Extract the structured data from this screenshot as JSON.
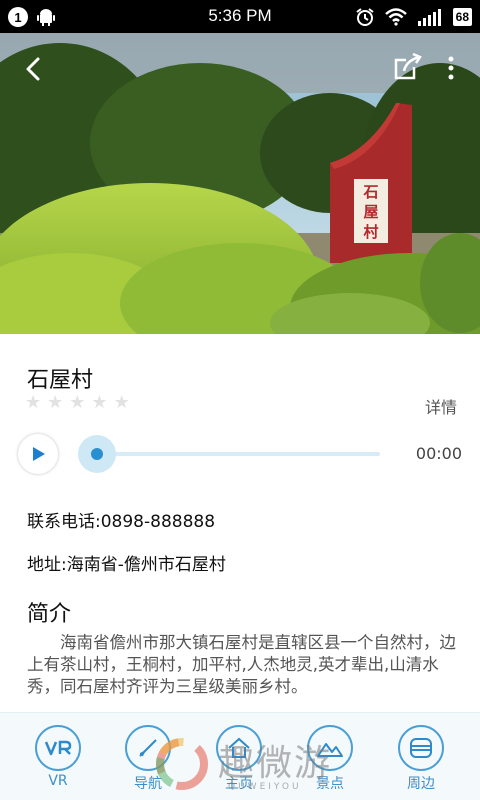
{
  "status_bar": {
    "notification_count": "1",
    "time": "5:36 PM",
    "battery": "68"
  },
  "hero": {
    "sign_text": "石屋村"
  },
  "place": {
    "name": "石屋村",
    "rating": 0,
    "rating_max": 5,
    "detail_label": "详情"
  },
  "audio": {
    "time": "00:00",
    "progress": 0
  },
  "contact": {
    "phone": "联系电话:0898-888888",
    "address": "地址:海南省-儋州市石屋村"
  },
  "intro": {
    "title": "简介",
    "text": "海南省儋州市那大镇石屋村是直辖区县一个自然村，边上有茶山村，王桐村，加平村,人杰地灵,英才辈出,山清水秀，同石屋村齐评为三星级美丽乡村。"
  },
  "bottom_nav": [
    {
      "label": "VR",
      "icon": "vr-icon"
    },
    {
      "label": "导航",
      "icon": "navigation-icon"
    },
    {
      "label": "主页",
      "icon": "home-icon"
    },
    {
      "label": "景点",
      "icon": "scenic-spot-icon"
    },
    {
      "label": "周边",
      "icon": "nearby-icon"
    }
  ],
  "watermark": {
    "text": "趣微游",
    "sub": "QUWEIYOU"
  },
  "colors": {
    "accent": "#2e8acb",
    "nav_background": "#f4f9fc",
    "sign_red": "#b3282d"
  }
}
